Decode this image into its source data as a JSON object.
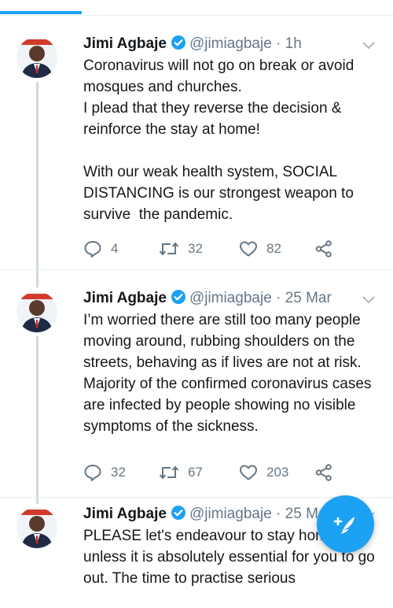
{
  "tabs": {
    "active_index": 0
  },
  "tweets": [
    {
      "name": "Jimi Agbaje",
      "handle": "@jimiagbaje",
      "time": "· 1h",
      "text": "Coronavirus will not go on break or avoid mosques and churches.\nI plead that they reverse the decision & reinforce the stay at home!\n\nWith our weak health system, SOCIAL DISTANCING is our strongest weapon to survive  the pandemic.",
      "replies": "4",
      "retweets": "32",
      "likes": "82"
    },
    {
      "name": "Jimi Agbaje",
      "handle": "@jimiagbaje",
      "time": "· 25 Mar",
      "text": "I’m worried there are still too many people moving around, rubbing shoulders on the streets, behaving as if lives are not at risk. Majority of the confirmed coronavirus cases are infected by people showing no visible symptoms of the sickness.",
      "replies": "32",
      "retweets": "67",
      "likes": "203"
    },
    {
      "name": "Jimi Agbaje",
      "handle": "@jimiagbaje",
      "time": "· 25 Mar",
      "text": "PLEASE let's endeavour to stay home unless it is absolutely essential for you to go out. The time to practise serious"
    }
  ],
  "icons": {
    "verified": "verified-badge-icon",
    "caret": "chevron-down-icon",
    "reply": "reply-icon",
    "retweet": "retweet-icon",
    "like": "heart-icon",
    "share": "share-icon",
    "compose": "compose-tweet-icon"
  },
  "colors": {
    "accent": "#1da1f2",
    "text": "#14171a",
    "secondary": "#657786"
  }
}
